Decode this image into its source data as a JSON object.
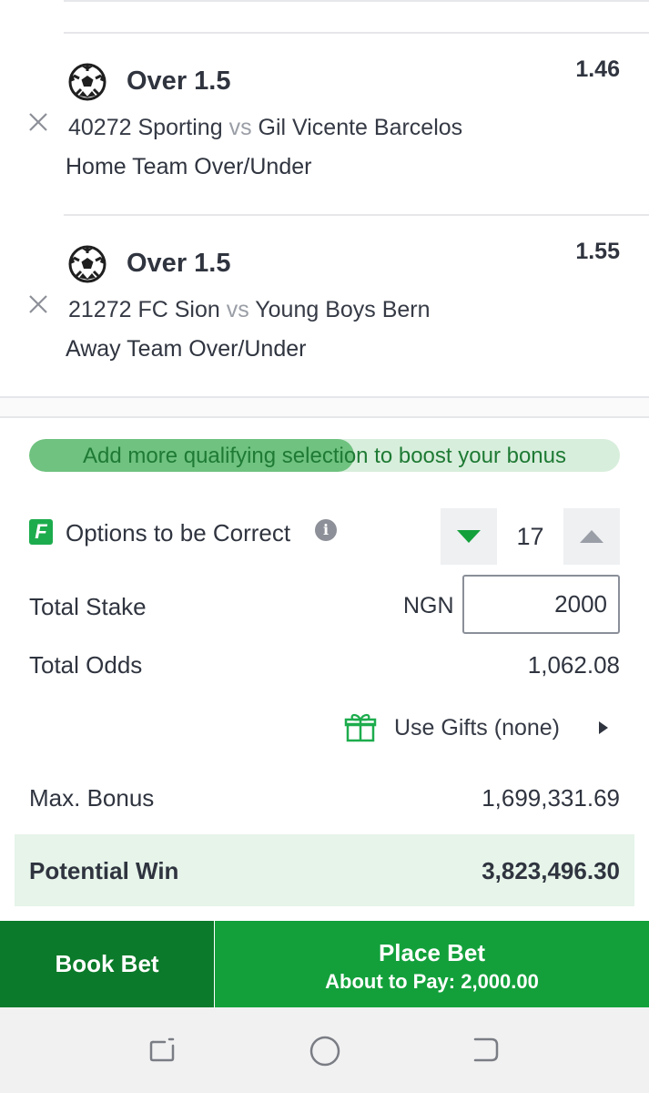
{
  "selections": [
    {
      "market": "Over 1.5",
      "odds": "1.46",
      "event_id": "40272",
      "home": "Sporting",
      "vs": "vs",
      "away": "Gil Vicente Barcelos",
      "market_type": "Home Team Over/Under",
      "icon": "soccer-ball-icon"
    },
    {
      "market": "Over 1.5",
      "odds": "1.55",
      "event_id": "21272",
      "home": "FC Sion",
      "vs": "vs",
      "away": "Young Boys Bern",
      "market_type": "Away Team Over/Under",
      "icon": "soccer-ball-icon"
    }
  ],
  "boost": {
    "text": "Add more qualifying selection to boost your bonus",
    "progress": 0.55
  },
  "options": {
    "badge": "F",
    "label": "Options to be Correct",
    "value": "17"
  },
  "stake": {
    "label": "Total Stake",
    "currency": "NGN",
    "value": "2000"
  },
  "odds": {
    "label": "Total Odds",
    "value": "1,062.08"
  },
  "gifts": {
    "label": "Use Gifts (none)"
  },
  "bonus": {
    "label": "Max. Bonus",
    "value": "1,699,331.69"
  },
  "potential": {
    "label": "Potential Win",
    "value": "3,823,496.30"
  },
  "actions": {
    "book_label": "Book Bet",
    "place_label": "Place Bet",
    "pay_label": "About to Pay: 2,000.00"
  },
  "colors": {
    "primary_green": "#13a03b",
    "dark_green": "#0b7a2a",
    "light_green_bg": "#e6f4e9"
  }
}
